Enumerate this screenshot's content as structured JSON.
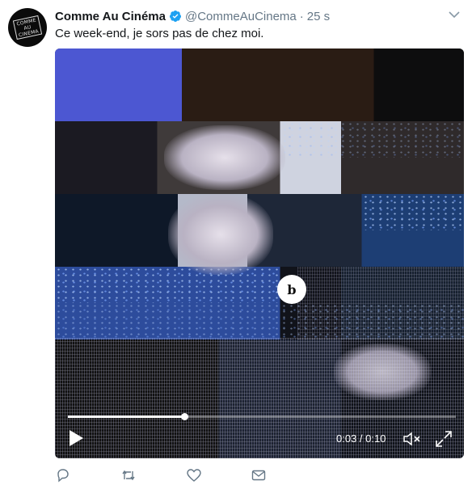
{
  "tweet": {
    "avatar": {
      "lines": [
        "COMME AU",
        "CINEMA"
      ]
    },
    "display_name": "Comme Au Cinéma",
    "handle": "@CommeAuCinema",
    "separator": "·",
    "time": "25 s",
    "text": "Ce week-end, je sors pas de chez moi.",
    "verified": true
  },
  "media": {
    "brand_badge": "b",
    "player": {
      "time_readout": "0:03 / 0:10",
      "progress": 0.3
    }
  },
  "actions": {
    "icons": [
      "reply-icon",
      "retweet-icon",
      "heart-icon",
      "envelope-icon"
    ]
  },
  "colors": {
    "verified": "#1da1f2",
    "action_icon": "#657786"
  }
}
